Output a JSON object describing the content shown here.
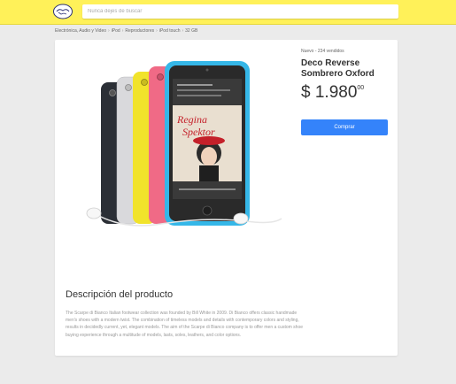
{
  "header": {
    "search_placeholder": "Nunca dejes de buscar"
  },
  "breadcrumb": [
    "Electrónica, Audio y Video",
    "iPod",
    "Reproductores",
    "iPod touch",
    "32 GB"
  ],
  "product": {
    "condition": "Nuevo - 234 vendidos",
    "title": "Deco Reverse Sombrero Oxford",
    "price_main": "$ 1.980",
    "price_cents": "00",
    "buy_label": "Comprar",
    "device_colors": [
      "#2b2f36",
      "#d9d9dc",
      "#f1e32b",
      "#f06a86",
      "#35b7e8"
    ]
  },
  "description": {
    "title": "Descripción del producto",
    "text": "The Scarpe di Bianco Italian footwear collection was founded by Bill White in 2009. Di Bianco offers classic handmade men's shoes with a modern twist. The combination of timeless models and details with contemporary colors and styling, results in decidedly current, yet, elegant models. The aim of the Scarpe di Bianco company is to offer men a custom shoe buying experience through a multitude of models, lasts, soles, leathers, and color options."
  },
  "colors": {
    "header": "#fff159",
    "buy_button": "#3483fa"
  }
}
